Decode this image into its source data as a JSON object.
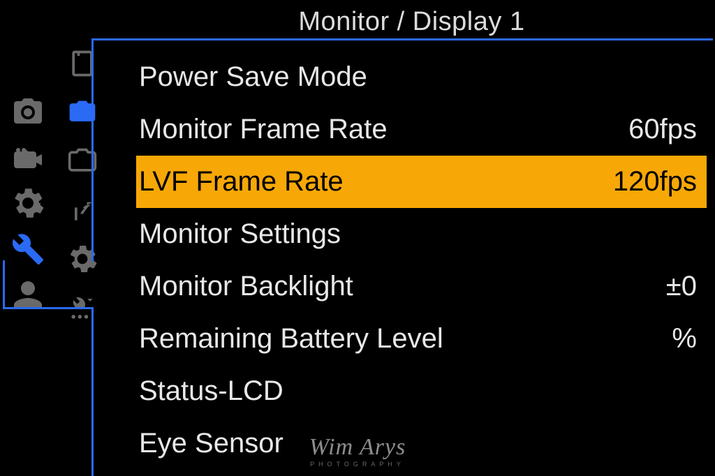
{
  "page_title": "Monitor / Display 1",
  "left_nav_selected_index": 3,
  "sub_nav_selected_index": 1,
  "menu": {
    "items": [
      {
        "label": "Power Save Mode",
        "value": "",
        "selected": false
      },
      {
        "label": "Monitor Frame Rate",
        "value": "60fps",
        "selected": false
      },
      {
        "label": "LVF Frame Rate",
        "value": "120fps",
        "selected": true
      },
      {
        "label": "Monitor Settings",
        "value": "",
        "selected": false
      },
      {
        "label": "Monitor Backlight",
        "value": "±0",
        "selected": false
      },
      {
        "label": "Remaining Battery Level",
        "value": "%",
        "selected": false
      },
      {
        "label": "Status-LCD",
        "value": "",
        "selected": false
      },
      {
        "label": "Eye Sensor",
        "value": "",
        "selected": false
      }
    ]
  },
  "watermark": {
    "main": "Wim Arys",
    "sub": "PHOTOGRAPHY"
  }
}
